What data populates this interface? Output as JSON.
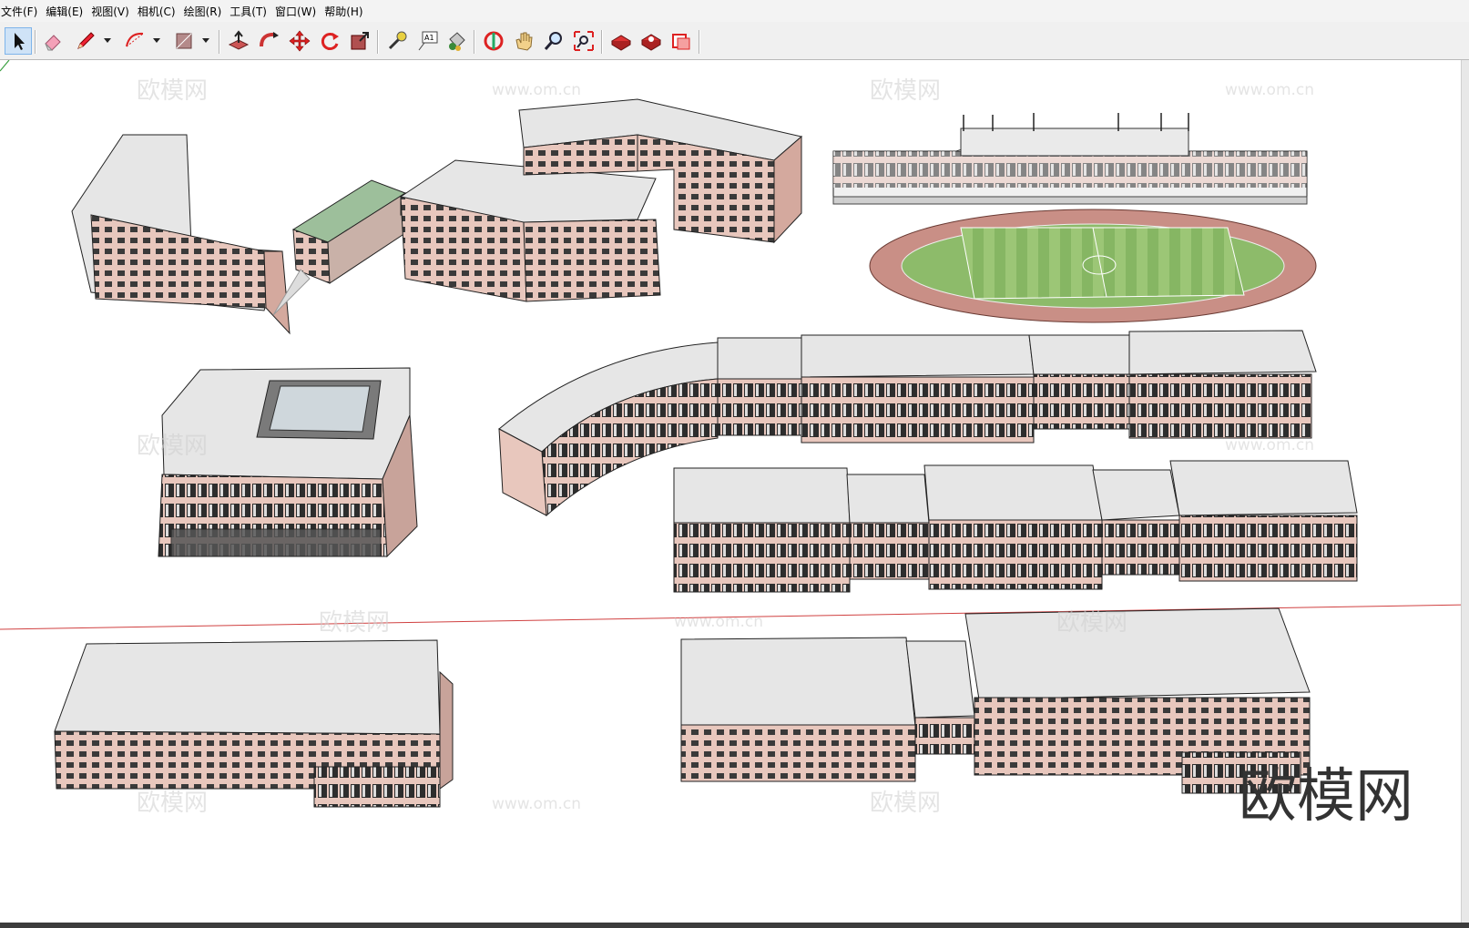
{
  "menu": {
    "file": "文件(F)",
    "edit": "编辑(E)",
    "view": "视图(V)",
    "camera": "相机(C)",
    "draw": "绘图(R)",
    "tools": "工具(T)",
    "window": "窗口(W)",
    "help": "帮助(H)"
  },
  "toolbar": {
    "items": [
      "select-icon",
      "eraser-icon",
      "pencil-icon",
      "arc-icon",
      "rectangle-icon",
      "push-pull-icon",
      "follow-me-icon",
      "move-icon",
      "rotate-icon",
      "scale-icon",
      "tape-measure-icon",
      "text-icon",
      "paint-bucket-icon",
      "orbit-icon",
      "pan-icon",
      "zoom-icon",
      "zoom-extents-icon",
      "warehouse-icon",
      "extension-warehouse-icon",
      "layout-icon"
    ],
    "text_tool_label": "A1"
  },
  "watermarks": {
    "logo": "欧模网",
    "url": "www.om.cn",
    "corner_logo": "欧模网"
  },
  "colors": {
    "accent_selected": "#cfe3f7",
    "brick": "#e8c7bd",
    "roof": "#e6e6e6",
    "field": "#8dbb6a",
    "track": "#c98f86",
    "axis_red": "#d04040",
    "axis_green": "#3aa040"
  }
}
